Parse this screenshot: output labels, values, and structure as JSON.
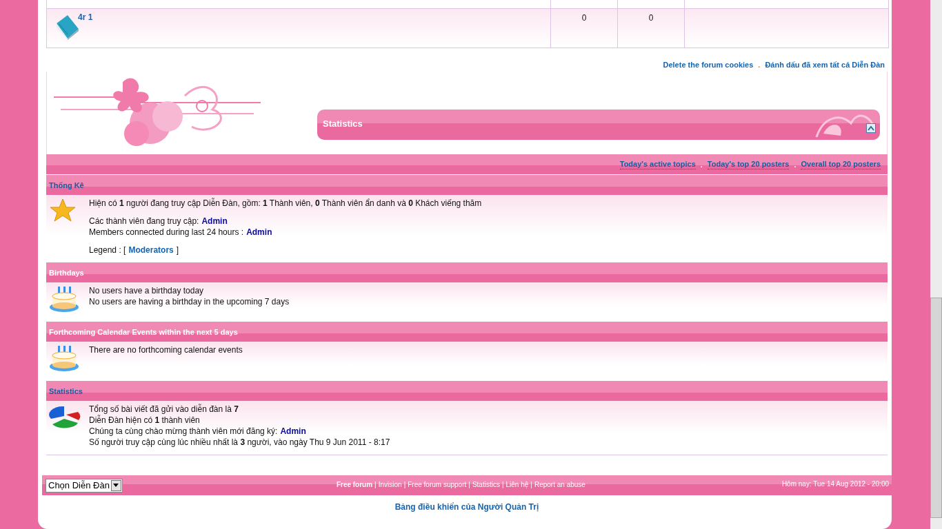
{
  "forum_row": {
    "title": "4r 1",
    "topics": "0",
    "posts": "0"
  },
  "top_links": {
    "items": [
      "Delete the forum cookies",
      "Đánh dấu đã xem tất cả Diễn Đàn"
    ],
    "separator": "."
  },
  "statistics_panel": {
    "title": "Statistics"
  },
  "stat_links": {
    "items": [
      "Today's active topics",
      "Today's top 20 posters",
      "Overall top 20 posters"
    ],
    "separator": "."
  },
  "sections": [
    {
      "title": "Thống Kê",
      "linked": true,
      "kind": "star",
      "paragraphs": [
        [
          [
            {
              "text": "Hiện có **1** người đang truy cập Diễn Đàn, gồm: **1** Thành viên, **0** Thành viên ẩn danh và **0** Khách viếng thăm"
            }
          ]
        ],
        [
          [
            {
              "text": "Các thành viên đang truy cập:"
            },
            {
              "link": "Admin",
              "kind": "user"
            }
          ],
          [
            {
              "text": "Members connected during last 24 hours :"
            },
            {
              "link": "Admin",
              "kind": "user"
            }
          ]
        ],
        [
          [
            {
              "text": "Legend :  ["
            },
            {
              "link": "Moderators",
              "kind": "group"
            },
            {
              "text": "]"
            }
          ]
        ]
      ]
    },
    {
      "title": "Birthdays",
      "linked": false,
      "kind": "cake",
      "paragraphs": [
        [
          [
            {
              "text": "No users have a birthday today"
            }
          ],
          [
            {
              "text": "No users are having a birthday in the upcoming 7 days"
            }
          ]
        ]
      ]
    },
    {
      "title": "Forthcoming Calendar Events within the next 5 days",
      "linked": false,
      "kind": "cake",
      "paragraphs": [
        [
          [
            {
              "text": "There are no forthcoming calendar events"
            }
          ]
        ]
      ]
    },
    {
      "title": "Statistics",
      "linked": true,
      "kind": "chart",
      "paragraphs": [
        [
          [
            {
              "text": "Tổng số bài viết đã gửi vào diễn đàn là **7**"
            }
          ],
          [
            {
              "text": "Diễn Đàn hiện có **1** thành viên"
            }
          ],
          [
            {
              "text": "Chúng ta cùng chào mừng thành viên mới đăng ký:"
            },
            {
              "link": "Admin",
              "kind": "user"
            }
          ],
          [
            {
              "text": "Số người truy cập cùng lúc nhiều nhất là **3** người, vào ngày Thu 9 Jun 2011 - 8:17"
            }
          ]
        ]
      ]
    }
  ],
  "footer_bar": {
    "select": "Chọn Diễn Đàn",
    "links": [
      {
        "label": "Free forum",
        "bold": true
      },
      {
        "label": "Invision",
        "bold": false
      },
      {
        "label": "Free forum support",
        "bold": false
      },
      {
        "label": "Statistics",
        "bold": false
      },
      {
        "label": "Liên hệ",
        "bold": false
      },
      {
        "label": "Report an abuse",
        "bold": false
      }
    ],
    "separator": "|",
    "date": "Hôm nay: Tue 14 Aug 2012 - 20:00"
  },
  "admin_link": "Bảng điều khiển của Người Quản Trị"
}
